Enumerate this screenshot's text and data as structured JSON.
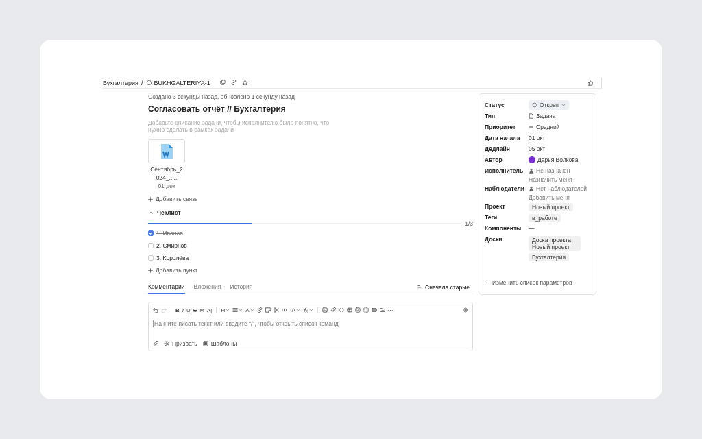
{
  "breadcrumbs": {
    "section": "Бухгалтерия",
    "separator": "/",
    "issue_key": "BUKHGALTERIYA-1"
  },
  "meta": "Создано 3 секунды назад, обновлено 1 секунду назад",
  "title": "Согласовать отчёт // Бухгалтерия",
  "description": {
    "placeholder": "Добавьте описание задачи, чтобы исполнителю было понятно, что нужно сделать в рамках задачи"
  },
  "attachments": [
    {
      "name_lines": [
        "Сентябрь_2",
        "024_....."
      ],
      "date": "01 дек"
    }
  ],
  "add_link": "Добавить связь",
  "checklist": {
    "title": "Чеклист",
    "expanded": true,
    "level": 0.333,
    "count": "1/3",
    "items": [
      {
        "label": "1. Иванов",
        "checked": true
      },
      {
        "label": "2. Смирнов",
        "checked": false
      },
      {
        "label": "3. Королёва",
        "checked": false
      }
    ],
    "add_item": "Добавить пункт"
  },
  "tabs": [
    {
      "label": "Комментарии",
      "selected": true
    },
    {
      "label": "Вложения",
      "selected": false
    },
    {
      "label": "История",
      "selected": false
    }
  ],
  "sort": "Сначала старые",
  "editor": {
    "placeholder": "Начните писать текст или введите \"/\", чтобы открыть список команд",
    "toolbar": [
      {
        "kind": "undo"
      },
      {
        "kind": "redo",
        "disabled": true
      },
      {
        "kind": "sep"
      },
      {
        "kind": "bold",
        "label": "B"
      },
      {
        "kind": "italic",
        "label": "I"
      },
      {
        "kind": "underline",
        "label": "U"
      },
      {
        "kind": "strike",
        "label": "S"
      },
      {
        "kind": "letter",
        "label": "M"
      },
      {
        "kind": "letter",
        "label": "A["
      },
      {
        "kind": "sep"
      },
      {
        "kind": "letter",
        "label": "H",
        "dropdown": true
      },
      {
        "kind": "list",
        "dropdown": true
      },
      {
        "kind": "letter",
        "label": "A",
        "dropdown": true
      },
      {
        "kind": "link"
      },
      {
        "kind": "note"
      },
      {
        "kind": "cut"
      },
      {
        "kind": "quote"
      },
      {
        "kind": "code",
        "dropdown": true
      },
      {
        "kind": "formula",
        "dropdown": true
      },
      {
        "kind": "sep"
      },
      {
        "kind": "image"
      },
      {
        "kind": "clip"
      },
      {
        "kind": "brackets"
      },
      {
        "kind": "table"
      },
      {
        "kind": "check"
      },
      {
        "kind": "dashed"
      },
      {
        "kind": "media"
      },
      {
        "kind": "folder"
      },
      {
        "kind": "letter",
        "label": "···"
      }
    ],
    "footer": [
      {
        "kind": "clip"
      },
      {
        "kind": "mention",
        "label": "Призвать"
      },
      {
        "kind": "template",
        "label": "Шаблоны"
      }
    ]
  },
  "fields": [
    {
      "label": "Статус",
      "kind": "status",
      "value": "Открыт"
    },
    {
      "label": "Тип",
      "kind": "type",
      "value": "Задача"
    },
    {
      "label": "Приоритет",
      "kind": "priority",
      "value": "Средний"
    },
    {
      "label": "Дата начала",
      "kind": "text",
      "value": "01 окт"
    },
    {
      "label": "Дедлайн",
      "kind": "text",
      "value": "05 окт"
    },
    {
      "label": "Автор",
      "kind": "user",
      "value": "Дарья Волкова"
    },
    {
      "label": "Исполнитель",
      "kind": "person",
      "value": "Не назначен",
      "action": "Назначить меня"
    },
    {
      "label": "Наблюдатели",
      "kind": "person",
      "value": "Нет наблюдателей",
      "action": "Добавить меня"
    },
    {
      "label": "Проект",
      "kind": "chips",
      "chips": [
        "Новый проект"
      ]
    },
    {
      "label": "Теги",
      "kind": "chips",
      "chips": [
        "в_работе"
      ]
    },
    {
      "label": "Компоненты",
      "kind": "dash",
      "value": "—"
    },
    {
      "label": "Доски",
      "kind": "chips",
      "chips": [
        "Доска проекта Новый проект",
        "Бухгалтерия"
      ]
    }
  ],
  "edit_params": "Изменить список параметров"
}
